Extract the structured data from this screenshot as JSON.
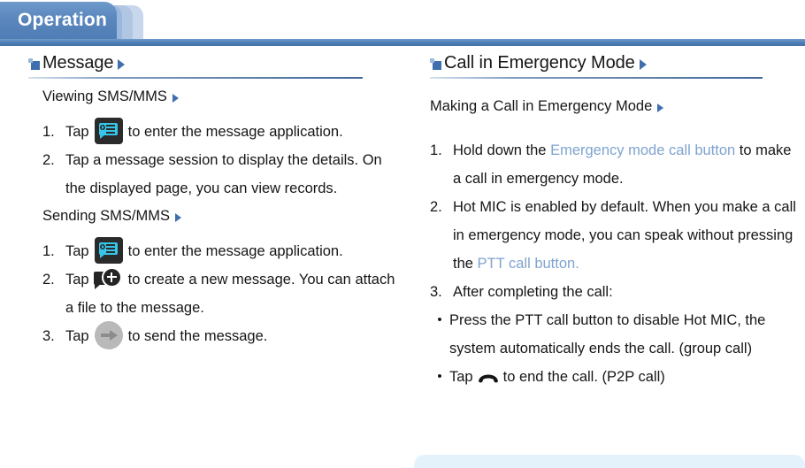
{
  "header": {
    "tab_label": "Operation",
    "bar_color": "#4d7cb4"
  },
  "colors": {
    "accent_blue": "#3f6fae",
    "link_blue": "#7fa3cf",
    "icon_cyan": "#35c6ea",
    "panel_blue": "#e4f3fb"
  },
  "left_column": {
    "section_title": "Message",
    "section_marker_icon": "blue-square-marker-icon",
    "section_arrow_icon": "triangle-right-icon",
    "subsections": [
      {
        "heading": "Viewing SMS/MMS",
        "heading_arrow_icon": "triangle-right-icon",
        "steps": [
          {
            "num": "1.",
            "pre": "Tap",
            "icon": "message-app-icon",
            "post": "to enter the message application."
          },
          {
            "num": "2.",
            "pre": "",
            "icon": "",
            "post": "Tap a message session to display the details. On the displayed page, you can view records."
          }
        ]
      },
      {
        "heading": "Sending SMS/MMS",
        "heading_arrow_icon": "triangle-right-icon",
        "steps": [
          {
            "num": "1.",
            "pre": "Tap",
            "icon": "message-app-icon",
            "post": "to enter the message application."
          },
          {
            "num": "2.",
            "pre": "Tap",
            "icon": "new-message-icon",
            "post": "to create a new message. You can attach a file to the message."
          },
          {
            "num": "3.",
            "pre": "Tap",
            "icon": "send-arrow-icon",
            "post": "to send the message."
          }
        ]
      }
    ]
  },
  "right_column": {
    "section_title": "Call in Emergency Mode",
    "section_marker_icon": "blue-square-marker-icon",
    "section_arrow_icon": "triangle-right-icon",
    "subsections": [
      {
        "heading": "Making a Call in Emergency Mode",
        "heading_arrow_icon": "triangle-right-icon",
        "steps": [
          {
            "num": "1.",
            "text_before": "Hold down the ",
            "link_text": "Emergency mode call button",
            "text_after": " to make a call in emergency mode."
          },
          {
            "num": "2.",
            "text_before": "Hot MIC is enabled by default. When you make a call in emergency mode, you can speak without pressing the ",
            "link_text": "PTT call button.",
            "text_after": ""
          },
          {
            "num": "3.",
            "text_before": "After completing the call:",
            "link_text": "",
            "text_after": ""
          }
        ],
        "bullets": [
          {
            "marker": "•",
            "pre": "Press the PTT call button to disable Hot MIC, the system automatically ends the call. (group call)",
            "icon": "",
            "post": ""
          },
          {
            "marker": "•",
            "pre": "Tap",
            "icon": "end-call-icon",
            "post": "to end the call. (P2P call)"
          }
        ]
      }
    ]
  }
}
